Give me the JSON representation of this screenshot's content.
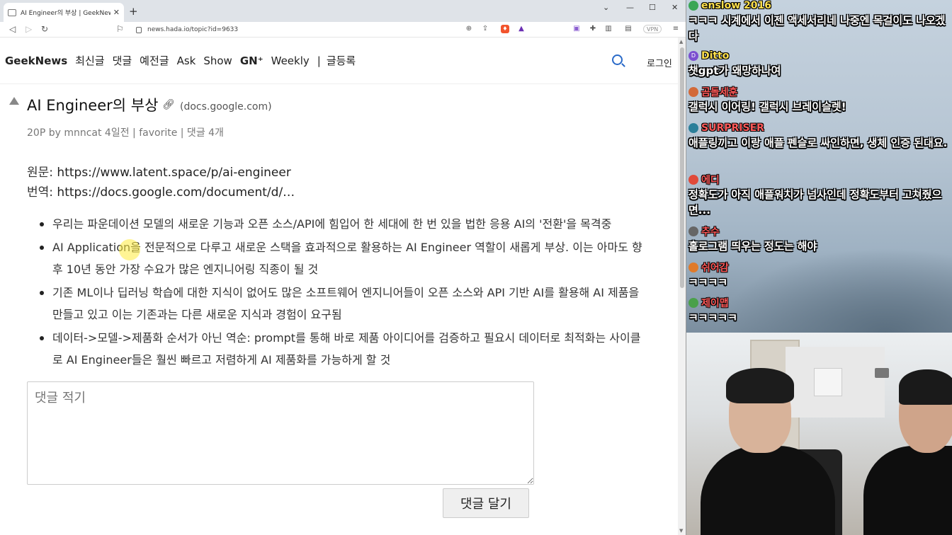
{
  "browser": {
    "tab_title": "AI Engineer의 부상 | GeekNews",
    "url": "news.hada.io/topic?id=9633",
    "vpn_label": "VPN"
  },
  "nav": {
    "brand": "GeekNews",
    "items": [
      "최신글",
      "댓글",
      "예전글",
      "Ask",
      "Show",
      "GN⁺",
      "Weekly"
    ],
    "separator": "|",
    "submit": "글등록",
    "login": "로그인"
  },
  "post": {
    "title": "AI Engineer의 부상",
    "domain": "(docs.google.com)",
    "meta": "20P by mnncat 4일전 | favorite | 댓글 4개",
    "source_label": "원문: ",
    "source_url": "https://www.latent.space/p/ai-engineer",
    "translation_label": "번역: ",
    "translation_url": "https://docs.google.com/document/d/…",
    "bullets": [
      "우리는 파운데이션 모델의 새로운 기능과 오픈 소스/API에 힘입어 한 세대에 한 번 있을 법한 응용 AI의 '전환'을 목격중",
      "AI Application을 전문적으로 다루고 새로운 스택을 효과적으로 활용하는 AI Engineer 역할이 새롭게 부상. 이는 아마도 향후 10년 동안 가장 수요가 많은 엔지니어링 직종이 될 것",
      "기존 ML이나 딥러닝 학습에 대한 지식이 없어도 많은 소프트웨어 엔지니어들이 오픈 소스와 API 기반 AI를 활용해 AI 제품을 만들고 있고 이는 기존과는 다른 새로운 지식과 경험이 요구됨",
      "데이터->모델->제품화 순서가 아닌 역순: prompt를 통해 바로 제품 아이디어를 검증하고 필요시 데이터로 최적화는 사이클로 AI Engineer들은 훨씬 빠르고 저렴하게 AI 제품화를 가능하게 할 것"
    ]
  },
  "comment": {
    "placeholder": "댓글 적기",
    "submit_label": "댓글 달기"
  },
  "chat": {
    "messages": [
      {
        "nick": "enslow 2016",
        "color": "#ffe14d",
        "avatar": "#3aa655",
        "text": "ㅋㅋㅋ 시계에서 이젠 액세서리네 나중엔 목걸이도 나오겠다"
      },
      {
        "nick": "Ditto",
        "color": "#ffe14d",
        "avatar": "#7b4fd0",
        "avatar_letter": "D",
        "text": "챗gpt가 왜망하나여"
      },
      {
        "nick": "곰돌세훈",
        "color": "#ff5a5a",
        "avatar": "#d26a3a",
        "text": "갤럭시 이어링! 갤럭시 브레이슬렛!"
      },
      {
        "nick": "SURPRISER",
        "color": "#ff5a5a",
        "avatar": "#2b7f9a",
        "text": "애플링끼고 이랑 애플 펜슬로 싸인하면, 생체 인증 된대요."
      },
      {
        "nick": "에디",
        "color": "#ff5a5a",
        "avatar": "#e04a3a",
        "text": "정확도가 아직 애플워치가 넘사인데 정확도부터 고쳐줬으면..."
      },
      {
        "nick": "추수",
        "color": "#ff5a5a",
        "avatar": "#666",
        "text": "홀로그램 띄우는 정도는 해야"
      },
      {
        "nick": "쉬어감",
        "color": "#ff5a5a",
        "avatar": "#e07a2a",
        "text": "ㅋㅋㅋㅋ"
      },
      {
        "nick": "제이맵",
        "color": "#ff5a5a",
        "avatar": "#4aa04a",
        "text": "ㅋㅋㅋㅋㅋ"
      }
    ]
  }
}
